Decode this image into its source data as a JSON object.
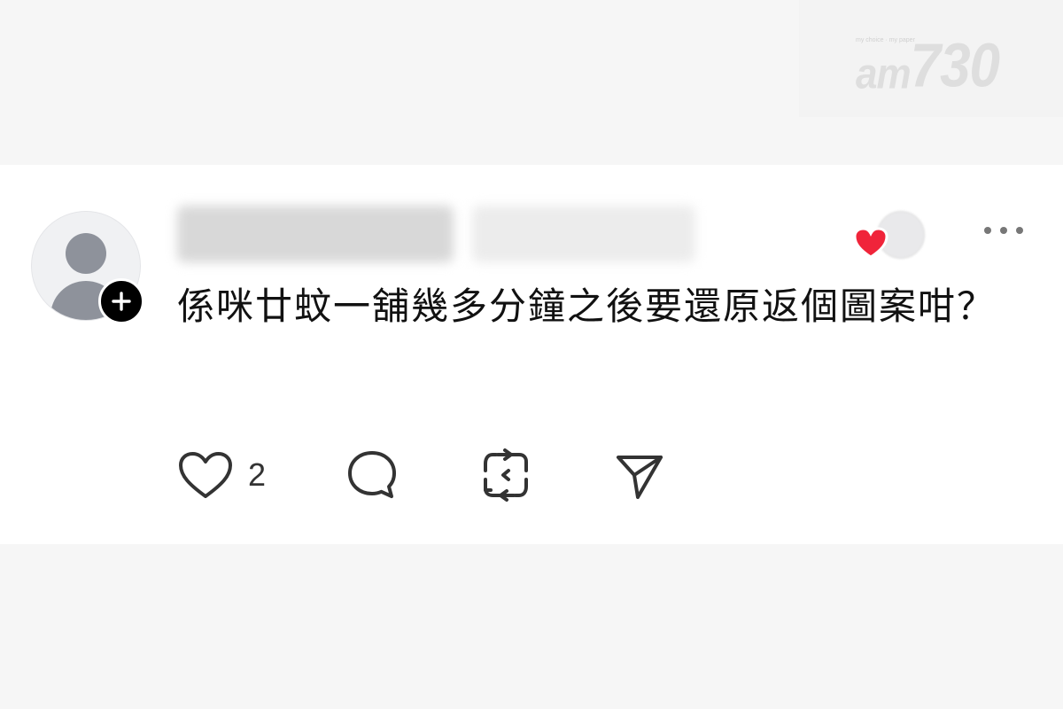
{
  "watermark": {
    "tagline": "my choice · my paper",
    "brand_letters": "am",
    "brand_number": "730"
  },
  "comment": {
    "text": "係咪廿蚊一舖幾多分鐘之後要還原返個圖案咁？",
    "like_count": "2"
  },
  "icons": {
    "avatar": "default-user-avatar",
    "follow": "plus-icon",
    "liked_by": "heart-icon",
    "more": "more-dots-icon",
    "like": "heart-outline-icon",
    "reply": "comment-bubble-icon",
    "repost": "repost-icon",
    "share": "send-icon"
  },
  "colors": {
    "liked_heart": "#f0243a",
    "text": "#111111",
    "icon": "#333333"
  }
}
